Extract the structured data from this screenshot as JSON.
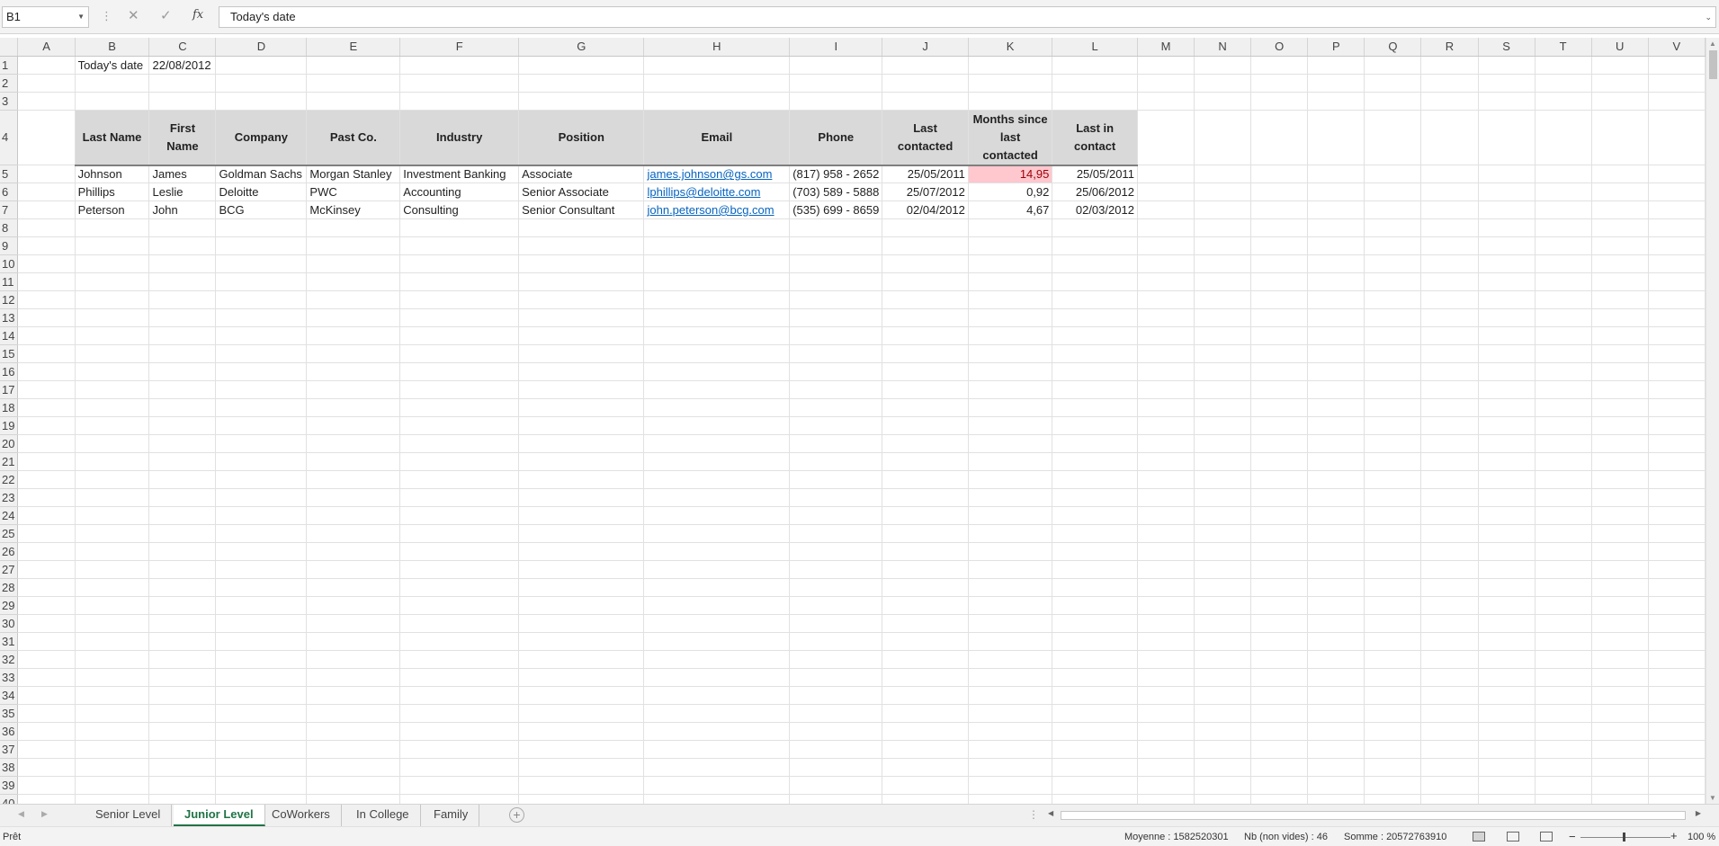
{
  "formula_bar": {
    "name_box": "B1",
    "cancel_icon": "✕",
    "enter_icon": "✓",
    "fx_label": "fx",
    "formula": "Today's date"
  },
  "columns": [
    "A",
    "B",
    "C",
    "D",
    "E",
    "F",
    "G",
    "H",
    "I",
    "J",
    "K",
    "L",
    "M",
    "N",
    "O",
    "P",
    "Q",
    "R",
    "S",
    "T",
    "U",
    "V"
  ],
  "rows_count": 41,
  "sheet": {
    "b1": "Today's date",
    "c1": "22/08/2012",
    "headers": [
      "Last Name",
      "First Name",
      "Company",
      "Past Co.",
      "Industry",
      "Position",
      "Email",
      "Phone",
      "Last contacted",
      "Months since last contacted",
      "Last in contact"
    ],
    "records": [
      [
        "Johnson",
        "James",
        "Goldman Sachs",
        "Morgan Stanley",
        "Investment Banking",
        "Associate",
        "james.johnson@gs.com",
        "(817) 958 - 2652",
        "25/05/2011",
        "14,95",
        "25/05/2011"
      ],
      [
        "Phillips",
        "Leslie",
        "Deloitte",
        "PWC",
        "Accounting",
        "Senior Associate",
        "lphillips@deloitte.com",
        "(703) 589 - 5888",
        "25/07/2012",
        "0,92",
        "25/06/2012"
      ],
      [
        "Peterson",
        "John",
        "BCG",
        "McKinsey",
        "Consulting",
        "Senior Consultant",
        "john.peterson@bcg.com",
        "(535) 699 - 8659",
        "02/04/2012",
        "4,67",
        "02/03/2012"
      ]
    ]
  },
  "tabs": [
    {
      "label": "Senior Level"
    },
    {
      "label": "Junior Level"
    },
    {
      "label": "CoWorkers"
    },
    {
      "label": "In College"
    },
    {
      "label": "Family"
    }
  ],
  "status": {
    "ready": "Prêt",
    "average": "Moyenne : 1582520301",
    "count": "Nb (non vides) : 46",
    "sum": "Somme : 20572763910",
    "zoom": "100 %"
  },
  "colors": {
    "accent": "#217346",
    "link": "#0563c1",
    "highlight_bg": "#ffc7ce",
    "highlight_fg": "#9c0006"
  }
}
